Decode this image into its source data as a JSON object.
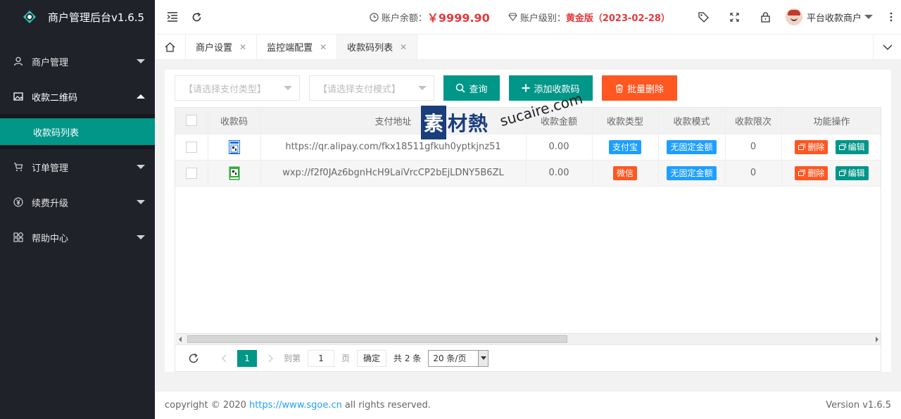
{
  "app": {
    "title": "商户管理后台v1.6.5"
  },
  "sidebar": {
    "items": [
      {
        "label": "商户管理",
        "icon": "user-icon"
      },
      {
        "label": "收款二维码",
        "icon": "image-icon",
        "open": true,
        "sub": [
          {
            "label": "收款码列表",
            "active": true
          }
        ]
      },
      {
        "label": "订单管理",
        "icon": "cart-icon"
      },
      {
        "label": "续费升级",
        "icon": "yen-icon"
      },
      {
        "label": "帮助中心",
        "icon": "apps-icon"
      }
    ]
  },
  "header": {
    "balance_label": "账户余额：",
    "balance_value": "￥9999.90",
    "level_label": "账户级别：",
    "level_value": "黄金版（2023-02-28）",
    "user_name": "平台收款商户"
  },
  "tabs": [
    {
      "label": "商户设置"
    },
    {
      "label": "监控端配置"
    },
    {
      "label": "收款码列表",
      "active": true
    }
  ],
  "toolbar": {
    "pay_type_placeholder": "【请选择支付类型】",
    "pay_mode_placeholder": "【请选择支付模式】",
    "query_label": "查询",
    "add_label": "添加收款码",
    "batch_delete_label": "批量删除"
  },
  "table": {
    "columns": [
      "收款码",
      "支付地址",
      "收款金额",
      "收款类型",
      "收款模式",
      "收款限次",
      "功能操作"
    ],
    "rows": [
      {
        "address": "https://qr.alipay.com/fkx18511gfkuh0yptkjnz51",
        "amount": "0.00",
        "type": "支付宝",
        "mode": "无固定金额",
        "limit": "0",
        "qr_color": "#1e6fd9"
      },
      {
        "address": "wxp://f2f0JAz6bgnHcH9LaiVrcCP2bEjLDNY5B6ZL",
        "amount": "0.00",
        "type": "微信",
        "mode": "无固定金额",
        "limit": "0",
        "qr_color": "#2eaa3a"
      }
    ],
    "delete_label": "删除",
    "edit_label": "编辑"
  },
  "pager": {
    "current_page": "1",
    "goto_label": "到第",
    "goto_value": "1",
    "page_label": "页",
    "ok_label": "确定",
    "total_label": "共 2 条",
    "page_size": "20 条/页"
  },
  "footer": {
    "copyright_prefix": "copyright © 2020",
    "link": "https://www.sgoe.cn",
    "copyright_suffix": "all rights reserved.",
    "version": "Version v1.6.5"
  },
  "watermark": {
    "cn": "素材熱",
    "latin": "sucaire.com"
  },
  "colors": {
    "sidebar_bg": "#20222a",
    "accent_teal": "#009688",
    "accent_orange": "#ff5722",
    "accent_blue": "#1e9fff",
    "price_red": "#e4393c"
  }
}
